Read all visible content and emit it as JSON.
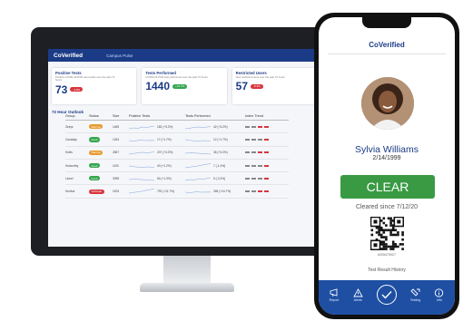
{
  "dashboard": {
    "logo": "CoVerified",
    "nav_label": "Campus Pulse",
    "cards": [
      {
        "title": "Positive Tests",
        "subtitle": "Positive COVID-19 PCR test results over the past 72 hours",
        "value": "73",
        "badge": "-3.8%",
        "badge_color": "#d8363c"
      },
      {
        "title": "Tests Performed",
        "subtitle": "COVID-19 PCR tests performed over the past 72 hours",
        "value": "1440",
        "badge": "+10.7%",
        "badge_color": "#36a64f"
      },
      {
        "title": "Restricted Users",
        "subtitle": "New restricted users over the past 72 hours",
        "value": "57",
        "badge": "-8.3%",
        "badge_color": "#d8363c"
      }
    ],
    "outlook_title": "72 Hour Outlook",
    "table": {
      "headers": [
        "Group",
        "Status",
        "Size",
        "Positive Tests",
        "Tests Performed",
        "Index Trend"
      ],
      "rows": [
        {
          "group": "Grays",
          "status": "Warning",
          "status_color": "#e89a2d",
          "size": "1465",
          "pos": "182 (+3.2%)",
          "tests": "42 (+3.2%)"
        },
        {
          "group": "Canaday",
          "status": "Good",
          "status_color": "#36a64f",
          "size": "1254",
          "pos": "17 (+1.7%)",
          "tests": "12 (+1.7%)"
        },
        {
          "group": "Hollis",
          "status": "Warning",
          "status_color": "#e89a2d",
          "size": "2567",
          "pos": "207 (+3.2%)",
          "tests": "36 (+3.2%)"
        },
        {
          "group": "Holworthy",
          "status": "Good",
          "status_color": "#36a64f",
          "size": "1190",
          "pos": "40 (+1.2%)",
          "tests": "7 (-1.4%)"
        },
        {
          "group": "Lionel",
          "status": "Good",
          "status_color": "#36a64f",
          "size": "3098",
          "pos": "54 (+1.3%)",
          "tests": "5 (-3.3%)"
        },
        {
          "group": "Hurlbut",
          "status": "Outbreak",
          "status_color": "#d8363c",
          "size": "1876",
          "pos": "792 (+11.7%)",
          "tests": "265 (+14.7%)"
        }
      ]
    }
  },
  "phone": {
    "brand": "CoVerified",
    "name": "Sylvia Williams",
    "dob": "2/14/1999",
    "status": "CLEAR",
    "status_color": "#3a9a44",
    "cleared_since": "Cleared since 7/12/20",
    "qr_id": "#205470927",
    "history_link": "Test Result History",
    "tabs": [
      {
        "label": "Report",
        "icon": "report-icon"
      },
      {
        "label": "Alerts",
        "icon": "alert-icon"
      },
      {
        "label": "",
        "icon": "check-icon"
      },
      {
        "label": "Testing",
        "icon": "test-tube-icon"
      },
      {
        "label": "Info",
        "icon": "info-icon"
      }
    ]
  }
}
